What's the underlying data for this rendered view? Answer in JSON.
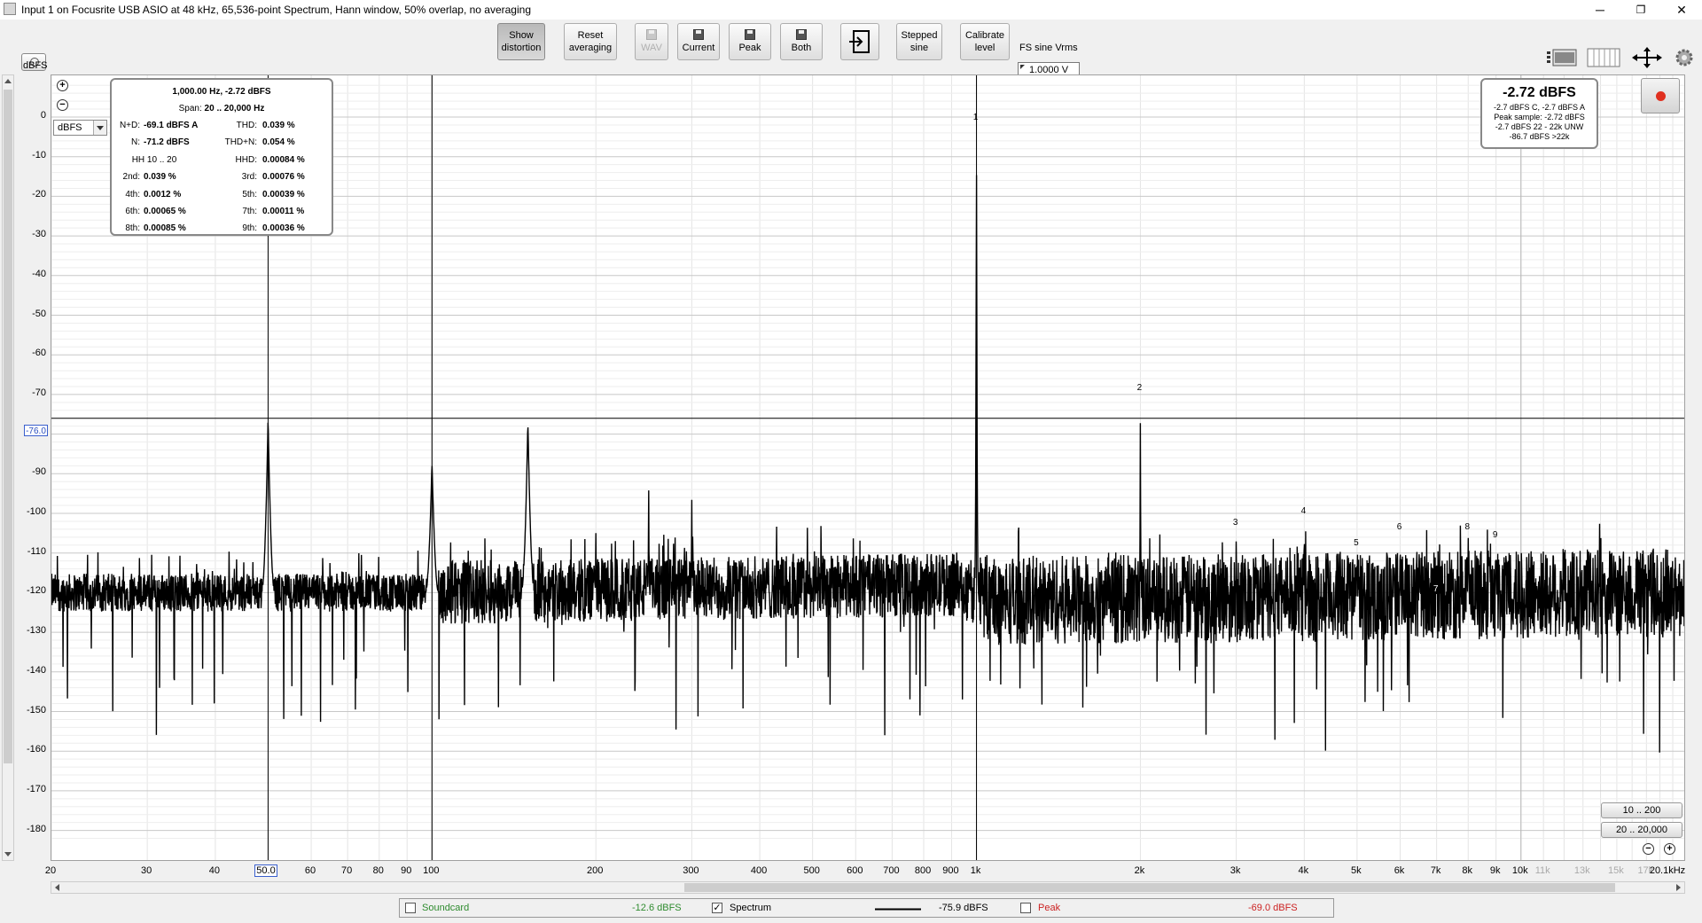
{
  "window": {
    "title": "Input 1 on Focusrite USB ASIO at 48 kHz, 65,536-point Spectrum, Hann window, 50% overlap, no averaging",
    "minimize": "─",
    "restore": "❐",
    "close": "✕"
  },
  "toolbar": {
    "show_distortion": [
      "Show",
      "distortion"
    ],
    "reset_averaging": [
      "Reset",
      "averaging"
    ],
    "wav": "WAV",
    "current": "Current",
    "peak": "Peak",
    "both": "Both",
    "stepped_sine": [
      "Stepped",
      "sine"
    ],
    "calibrate_level": [
      "Calibrate",
      "level"
    ],
    "fs_label": "FS sine Vrms",
    "fs_value": "1.0000 V"
  },
  "plot": {
    "y_unit": "dBFS",
    "unit_select": "dBFS",
    "y_cursor_label": "-76.0",
    "x_cursor_label": "50.0"
  },
  "distortion_panel": {
    "header1": "1,000.00 Hz, -2.72 dBFS",
    "span_label": "Span:",
    "span_value": "20 .. 20,000 Hz",
    "rows": [
      {
        "l1": "N+D:",
        "v1": "-69.1 dBFS A",
        "l2": "THD:",
        "v2": "0.039 %"
      },
      {
        "l1": "N:",
        "v1": "-71.2 dBFS",
        "l2": "THD+N:",
        "v2": "0.054 %"
      },
      {
        "l1": "HH 10 .. 20",
        "v1": "",
        "l2": "HHD:",
        "v2": "0.00084 %"
      },
      {
        "l1": "2nd:",
        "v1": "0.039 %",
        "l2": "3rd:",
        "v2": "0.00076 %"
      },
      {
        "l1": "4th:",
        "v1": "0.0012 %",
        "l2": "5th:",
        "v2": "0.00039 %"
      },
      {
        "l1": "6th:",
        "v1": "0.00065 %",
        "l2": "7th:",
        "v2": "0.00011 %"
      },
      {
        "l1": "8th:",
        "v1": "0.00085 %",
        "l2": "9th:",
        "v2": "0.00036 %"
      }
    ]
  },
  "level_panel": {
    "big": "-2.72 dBFS",
    "lines": [
      "-2.7 dBFS C, -2.7 dBFS A",
      "Peak sample: -2.72 dBFS",
      "-2.7 dBFS 22 - 22k UNW",
      "-86.7 dBFS >22k"
    ]
  },
  "range_buttons": [
    "10 .. 200",
    "20 .. 20,000"
  ],
  "legend": {
    "soundcard": {
      "label": "Soundcard",
      "value": "-12.6 dBFS",
      "checked": false,
      "color": "#2e8b2e"
    },
    "spectrum": {
      "label": "Spectrum",
      "value": "-75.9 dBFS",
      "checked": true,
      "color": "#000000"
    },
    "peak": {
      "label": "Peak",
      "value": "-69.0 dBFS",
      "checked": false,
      "color": "#cc2222"
    }
  },
  "chart_data": {
    "type": "line",
    "title": "",
    "xlabel": "",
    "ylabel": "dBFS",
    "xscale": "log",
    "xlim": [
      20,
      20100
    ],
    "ylim": [
      -180,
      8
    ],
    "x_ticks": [
      "20",
      "30",
      "40",
      "50.0",
      "60",
      "70",
      "80",
      "90",
      "100",
      "200",
      "300",
      "400",
      "500",
      "600",
      "700",
      "800",
      "900",
      "1k",
      "2k",
      "3k",
      "4k",
      "5k",
      "6k",
      "7k",
      "8k",
      "9k",
      "10k",
      "11k",
      "13k",
      "15k",
      "17k",
      "20.1kHz"
    ],
    "x_tick_values": [
      20,
      30,
      40,
      50,
      60,
      70,
      80,
      90,
      100,
      200,
      300,
      400,
      500,
      600,
      700,
      800,
      900,
      1000,
      2000,
      3000,
      4000,
      5000,
      6000,
      7000,
      8000,
      9000,
      10000,
      11000,
      13000,
      15000,
      17000,
      20100
    ],
    "y_ticks": [
      0,
      -10,
      -20,
      -30,
      -40,
      -50,
      -60,
      -70,
      -80,
      -90,
      -100,
      -110,
      -120,
      -130,
      -140,
      -150,
      -160,
      -170,
      -180
    ],
    "grid": true,
    "cursor": {
      "x": 50,
      "y": -76
    },
    "peaks": [
      {
        "x": 50,
        "y": -76
      },
      {
        "x": 100,
        "y": -87
      },
      {
        "x": 150,
        "y": -77
      },
      {
        "x": 200,
        "y": -104
      },
      {
        "x": 250,
        "y": -93
      },
      {
        "x": 300,
        "y": -95
      },
      {
        "x": 1000,
        "y": -2.72
      },
      {
        "x": 2000,
        "y": -71
      },
      {
        "x": 3000,
        "y": -105
      },
      {
        "x": 4000,
        "y": -102
      },
      {
        "x": 5000,
        "y": -110
      },
      {
        "x": 6000,
        "y": -106
      },
      {
        "x": 7000,
        "y": -115
      },
      {
        "x": 8000,
        "y": -106
      },
      {
        "x": 9000,
        "y": -108
      }
    ],
    "harmonic_labels": [
      {
        "label": "1",
        "x": 1000,
        "y": -2.72
      },
      {
        "label": "2",
        "x": 2000,
        "y": -71
      },
      {
        "label": "3",
        "x": 3000,
        "y": -105
      },
      {
        "label": "4",
        "x": 4000,
        "y": -102
      },
      {
        "label": "5",
        "x": 5000,
        "y": -110
      },
      {
        "label": "6",
        "x": 6000,
        "y": -106
      },
      {
        "label": "7",
        "x": 7000,
        "y": -120
      },
      {
        "label": "8",
        "x": 8000,
        "y": -106
      },
      {
        "label": "9",
        "x": 9000,
        "y": -108
      }
    ],
    "noise_floor": [
      {
        "x": 20,
        "y": -120
      },
      {
        "x": 100,
        "y": -120
      },
      {
        "x": 900,
        "y": -118
      },
      {
        "x": 1100,
        "y": -122
      },
      {
        "x": 20100,
        "y": -120
      }
    ]
  }
}
